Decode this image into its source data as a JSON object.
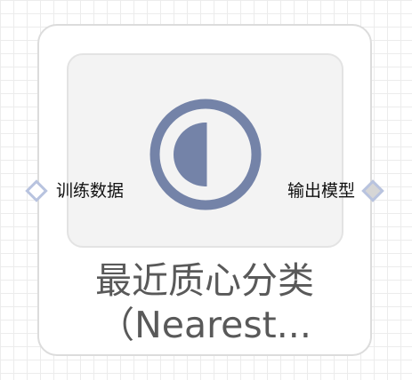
{
  "node": {
    "title_line_1": "最近质心分类",
    "title_line_2": "（Nearest...",
    "icon": "half-filled-circle-icon",
    "colors": {
      "icon": "#7483a8",
      "port_border": "#b8c3df",
      "title_text": "#595959"
    },
    "input_port": {
      "label": "训练数据"
    },
    "output_port": {
      "label": "输出模型"
    }
  }
}
